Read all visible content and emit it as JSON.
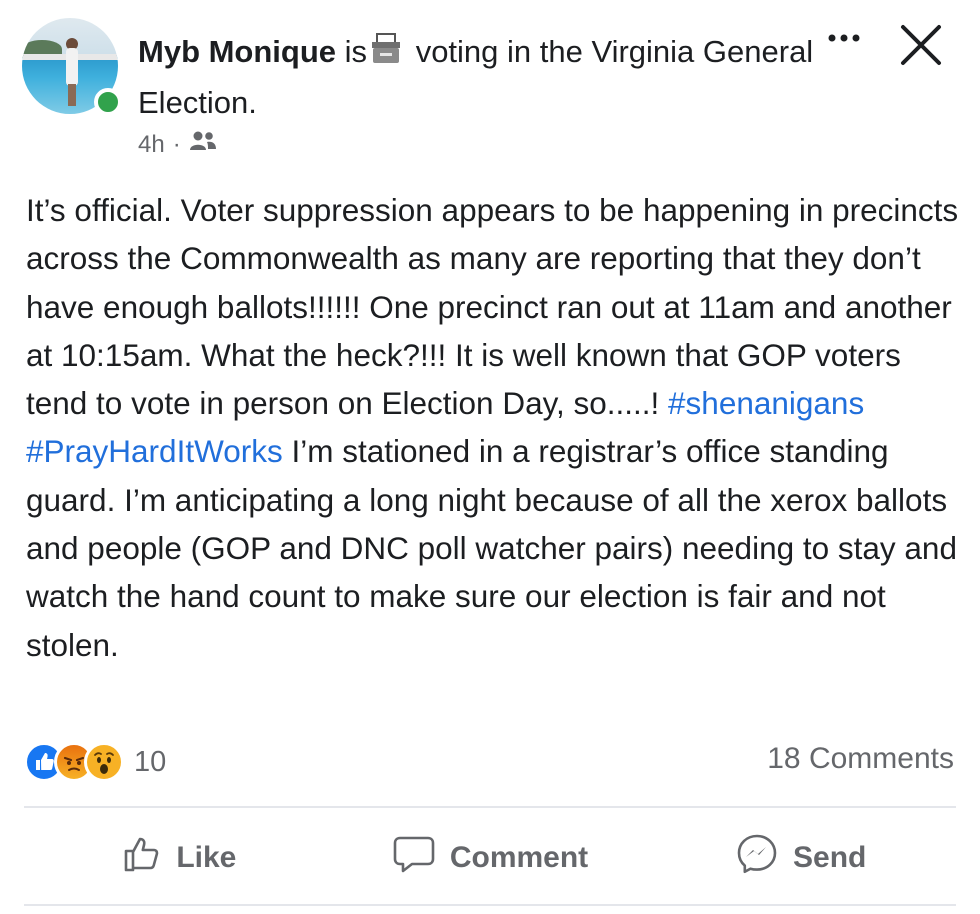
{
  "post": {
    "author": "Myb Monique",
    "activity_prefix": "is",
    "activity": "voting in the Virginia General Election.",
    "time": "4h",
    "separator": "·",
    "audience_icon": "friends-icon",
    "header_icons": [
      "more-icon",
      "close-icon"
    ],
    "body": {
      "text_1": "It’s official. Voter suppression appears to be happening in precincts across the Commonwealth as many are reporting that they don’t have enough ballots!!!!!! One precinct ran out at 11am and another at 10:15am. What the heck?!!! It is well known that GOP voters tend to vote in person on Election Day, so.....! ",
      "tag_1": "#shenanigans",
      "tag_2": "#PrayHardItWorks",
      "text_2": " I’m stationed in a registrar’s office standing guard. I’m anticipating a long night because of all the xerox ballots and people (GOP and DNC poll watcher pairs) needing to stay and watch the hand count to make sure our election is fair and not stolen."
    },
    "reactions": {
      "types": [
        "like",
        "angry",
        "wow"
      ],
      "count": "10"
    },
    "comments_count": "18 Comments",
    "actions": {
      "like": "Like",
      "comment": "Comment",
      "send": "Send"
    },
    "colors": {
      "link": "#216fdb",
      "secondary_text": "#65676b",
      "online": "#31a24c",
      "like_blue": "#1877f2"
    }
  }
}
